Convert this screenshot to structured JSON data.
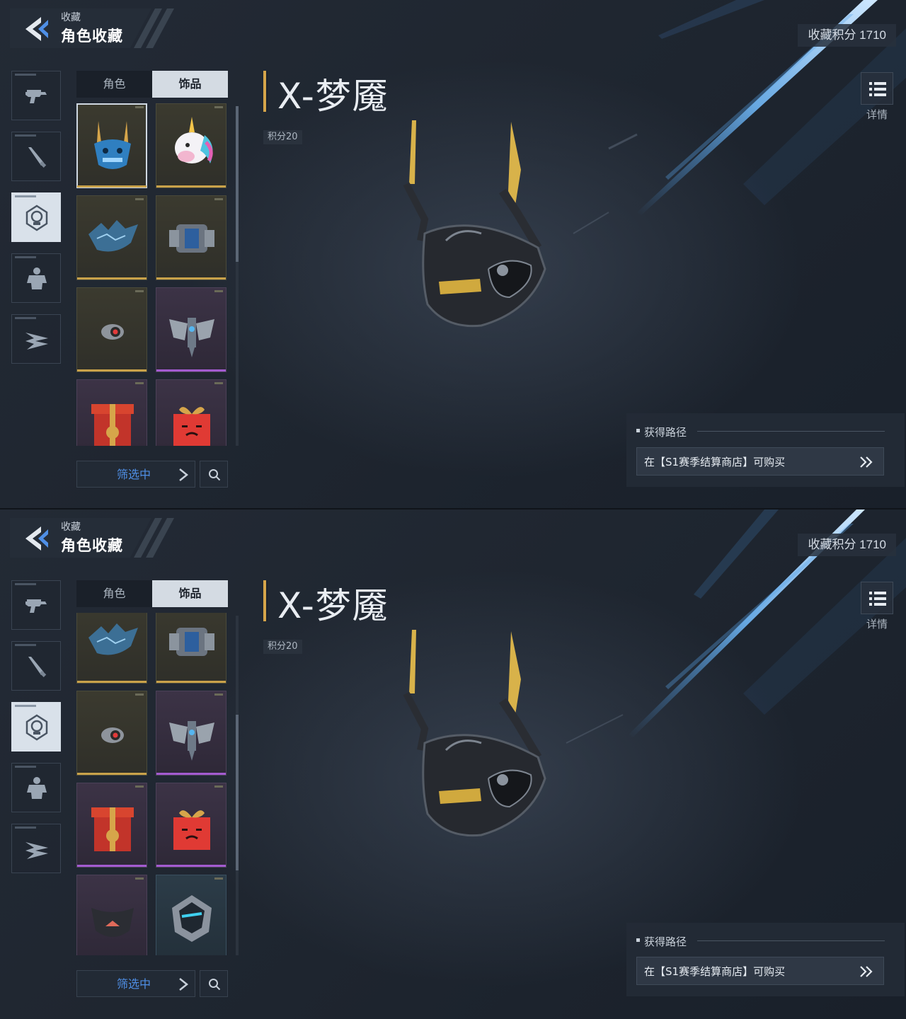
{
  "header": {
    "small": "收藏",
    "title": "角色收藏"
  },
  "score_badge": "收藏积分 1710",
  "tabs": [
    {
      "label": "角色"
    },
    {
      "label": "饰品"
    }
  ],
  "side_categories": [
    {
      "icon": "pistol-icon"
    },
    {
      "icon": "knife-icon"
    },
    {
      "icon": "skull-mask-icon"
    },
    {
      "icon": "armor-icon"
    },
    {
      "icon": "wings-icon"
    }
  ],
  "item": {
    "name": "X-梦魇",
    "score": "积分20"
  },
  "details_label": "详情",
  "filter_label": "筛选中",
  "acquisition": {
    "title": "获得路径",
    "text": "在【S1赛季结算商店】可购买"
  },
  "screens": [
    {
      "grid": [
        {
          "icon": "blue-demon-mask-icon",
          "rarity": "gold"
        },
        {
          "icon": "unicorn-head-icon",
          "rarity": "gold"
        },
        {
          "icon": "dragon-mask-icon",
          "rarity": "gold"
        },
        {
          "icon": "mech-backpack-icon",
          "rarity": "gold"
        },
        {
          "icon": "red-eye-device-icon",
          "rarity": "gold"
        },
        {
          "icon": "winged-ornament-icon",
          "rarity": "purple"
        },
        {
          "icon": "treasure-box-icon",
          "rarity": "purple"
        },
        {
          "icon": "gift-box-icon",
          "rarity": "purple"
        }
      ]
    },
    {
      "grid": [
        {
          "icon": "dragon-mask-icon",
          "rarity": "gold"
        },
        {
          "icon": "mech-backpack-icon",
          "rarity": "gold"
        },
        {
          "icon": "red-eye-device-icon",
          "rarity": "gold"
        },
        {
          "icon": "winged-ornament-icon",
          "rarity": "purple"
        },
        {
          "icon": "treasure-box-icon",
          "rarity": "purple"
        },
        {
          "icon": "gift-box-icon",
          "rarity": "purple"
        },
        {
          "icon": "cloth-mask-icon",
          "rarity": "purple"
        },
        {
          "icon": "cyber-helmet-icon",
          "rarity": "cyan"
        }
      ]
    }
  ],
  "colors": {
    "accent_gold": "#d6a54a",
    "filter_blue": "#4f8fe6",
    "rarity_gold": "#c9a24a",
    "rarity_purple": "#a35bd0",
    "rarity_cyan": "#4fb0d8"
  }
}
